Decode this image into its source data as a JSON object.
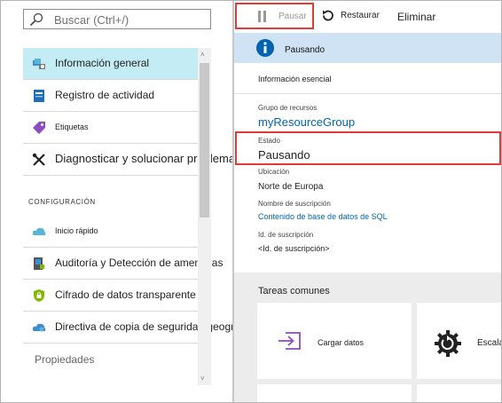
{
  "search": {
    "placeholder": "Buscar (Ctrl+/)"
  },
  "sidebar": {
    "items": [
      {
        "label": "Información general",
        "icon": "overview-icon"
      },
      {
        "label": "Registro de actividad",
        "icon": "activity-log-icon"
      },
      {
        "label": "Etiquetas",
        "icon": "tag-icon"
      },
      {
        "label": "Diagnosticar y solucionar problemas",
        "icon": "wrench-icon"
      }
    ],
    "section_config": "CONFIGURACIÓN",
    "config_items": [
      {
        "label": "Inicio rápido",
        "icon": "cloud-quickstart-icon"
      },
      {
        "label": "Auditoría y Detección de amenazas",
        "icon": "audit-icon"
      },
      {
        "label": "Cifrado de datos transparente",
        "icon": "shield-lock-icon"
      },
      {
        "label": "Directiva de copia de seguridad geográfica",
        "icon": "cloud-backup-icon"
      }
    ],
    "properties_label": "Propiedades"
  },
  "toolbar": {
    "pause_label": "Pausar",
    "restore_label": "Restaurar",
    "delete_label": "Eliminar"
  },
  "banner": {
    "status": "Pausando"
  },
  "essentials": {
    "header": "Información esencial",
    "resource_group_label": "Grupo de recursos",
    "resource_group_value": "myResourceGroup",
    "state_label": "Estado",
    "state_value": "Pausando",
    "location_label": "Ubicación",
    "location_value": "Norte de Europa",
    "subscription_name_label": "Nombre de suscripción",
    "subscription_name_value": "Contenido de base de datos de SQL",
    "subscription_id_label": "Id. de suscripción",
    "subscription_id_value": "<Id. de suscripción>"
  },
  "common_tasks": {
    "title": "Tareas comunes",
    "tiles": [
      {
        "label": "Cargar datos",
        "icon": "load-data-icon"
      },
      {
        "label": "Escala",
        "icon": "scale-gear-icon"
      }
    ]
  },
  "colors": {
    "active_item": "#c3ecf5",
    "banner_bg": "#cfe3f5",
    "highlight_border": "#e03b35",
    "link": "#0063b1",
    "tiles_bg": "#ececec"
  }
}
